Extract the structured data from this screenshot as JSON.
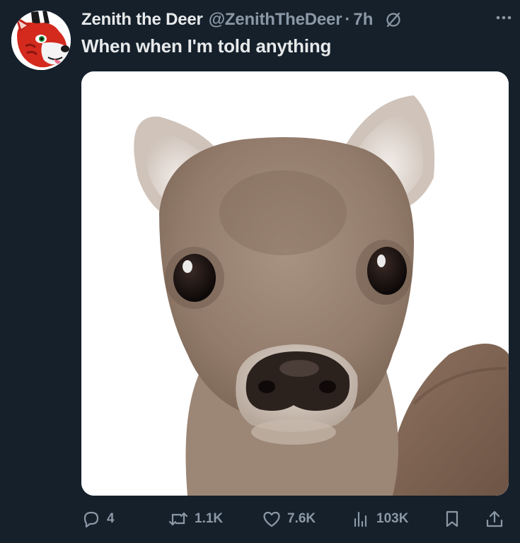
{
  "tweet": {
    "author_name": "Zenith the Deer",
    "handle": "@ZenithTheDeer",
    "separator": "·",
    "timestamp": "7h",
    "text": "When when I'm told anything",
    "media_subject": "fawn-photo"
  },
  "actions": {
    "replies": "4",
    "retweets": "1.1K",
    "likes": "7.6K",
    "views": "103K"
  },
  "icons": {
    "header": [
      "reply-restricted-icon",
      "more-icon"
    ],
    "actions": [
      "reply-icon",
      "retweet-icon",
      "like-icon",
      "views-icon",
      "bookmark-icon",
      "share-icon"
    ]
  },
  "colors": {
    "background": "#15202b",
    "primary_text": "#e7e9ea",
    "secondary_text": "#8b98a5",
    "avatar_red": "#d42a1e"
  }
}
